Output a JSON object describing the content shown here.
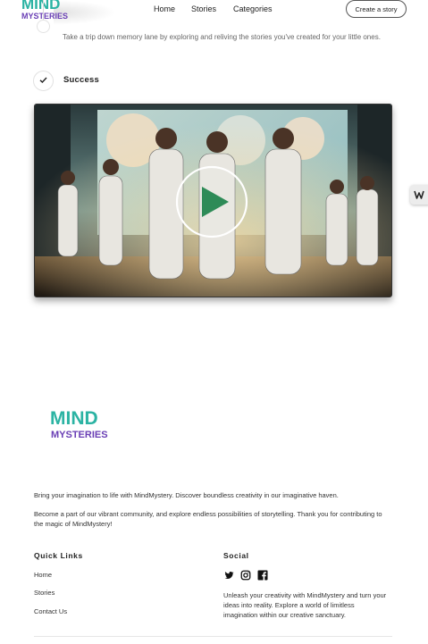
{
  "header": {
    "logo_line1": "MIND",
    "logo_line2": "MYSTERIES",
    "nav": [
      "Home",
      "Stories",
      "Categories"
    ],
    "cta": "Create a story"
  },
  "timeline": {
    "step_text": "Take a trip down memory lane by exploring and reliving the stories you've created for your little ones.",
    "success_label": "Success"
  },
  "video": {
    "poster_scene": "astronaut-crew-illustration",
    "play_icon": "play-icon",
    "accent": "#2e8b57"
  },
  "side_tab": {
    "icon": "w-icon"
  },
  "footer": {
    "logo_line1": "MIND",
    "logo_line2": "MYSTERIES",
    "para1": "Bring your imagination to life with MindMystery. Discover boundless creativity in our imaginative haven.",
    "para2": "Become a part of our vibrant community, and explore endless possibilities of storytelling. Thank you for contributing to the magic of MindMystery!",
    "quick_links_title": "Quick Links",
    "quick_links": [
      "Home",
      "Stories",
      "Contact Us"
    ],
    "social_title": "Social",
    "social_icons": [
      "twitter-icon",
      "instagram-icon",
      "facebook-icon"
    ],
    "social_text": "Unleash your creativity with MindMystery and turn your ideas into reality. Explore a world of limitless imagination within our creative sanctuary."
  },
  "colors": {
    "logo_mind_1": "#2bb3a3",
    "logo_mind_2": "#e8397a",
    "logo_mind_3": "#f2a42a",
    "logo_mysteries": "#6a3fb5"
  }
}
